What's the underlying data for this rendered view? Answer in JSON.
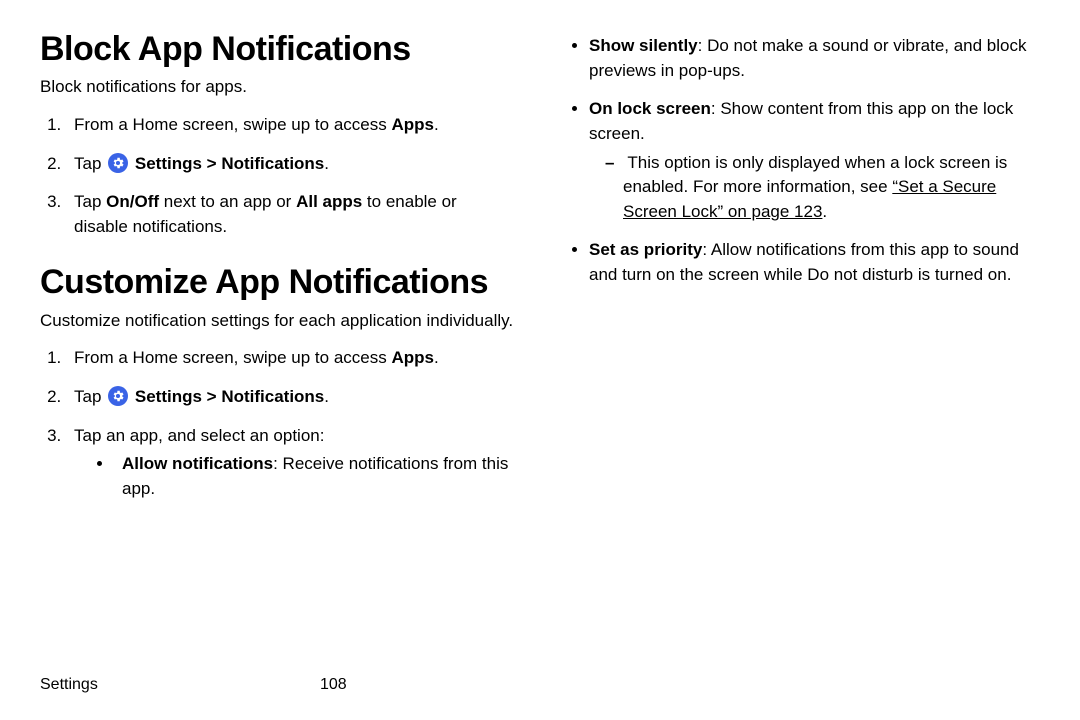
{
  "left": {
    "h1": "Block App Notifications",
    "intro1": "Block notifications for apps.",
    "step1a": "From a Home screen, swipe up to access ",
    "step1b": "Apps",
    "step1c": ".",
    "step2a": "Tap ",
    "step2b": "Settings",
    "step2c": " > ",
    "step2d": "Notifications",
    "step2e": ".",
    "step3a": "Tap ",
    "step3b": "On/Off",
    "step3c": " next to an app or ",
    "step3d": "All apps",
    "step3e": " to enable or disable notifications.",
    "h2": "Customize App Notifications",
    "intro2": "Customize notification settings for each application individually.",
    "c1a": "From a Home screen, swipe up to access ",
    "c1b": "Apps",
    "c1c": ".",
    "c2a": "Tap ",
    "c2b": "Settings",
    "c2c": " > ",
    "c2d": "Notifications",
    "c2e": ".",
    "c3": "Tap an app, and select an option:",
    "b1a": "Allow notifications",
    "b1b": ": Receive notifications from this app."
  },
  "right": {
    "b2a": "Show silently",
    "b2b": ": Do not make a sound or vibrate, and block previews in pop-ups.",
    "b3a": "On lock screen",
    "b3b": ": Show content from this app on the lock screen.",
    "d1a": "This option is only displayed when a lock screen is enabled. For more information, see ",
    "d1b": "“Set a Secure Screen Lock” on page 123",
    "d1c": ".",
    "b4a": "Set as priority",
    "b4b": ": Allow notifications from this app to sound and turn on the screen while Do not disturb is turned on."
  },
  "footer": {
    "section": "Settings",
    "page": "108"
  }
}
